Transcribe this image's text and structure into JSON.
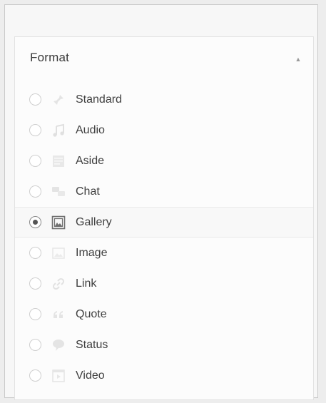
{
  "panel": {
    "title": "Format",
    "toggle_icon": "▲"
  },
  "formats": [
    {
      "label": "Standard",
      "icon": "pin-icon",
      "selected": false
    },
    {
      "label": "Audio",
      "icon": "music-note-icon",
      "selected": false
    },
    {
      "label": "Aside",
      "icon": "aside-doc-icon",
      "selected": false
    },
    {
      "label": "Chat",
      "icon": "chat-bubbles-icon",
      "selected": false
    },
    {
      "label": "Gallery",
      "icon": "gallery-icon",
      "selected": true
    },
    {
      "label": "Image",
      "icon": "image-icon",
      "selected": false
    },
    {
      "label": "Link",
      "icon": "link-icon",
      "selected": false
    },
    {
      "label": "Quote",
      "icon": "quote-icon",
      "selected": false
    },
    {
      "label": "Status",
      "icon": "status-bubble-icon",
      "selected": false
    },
    {
      "label": "Video",
      "icon": "video-icon",
      "selected": false
    }
  ]
}
